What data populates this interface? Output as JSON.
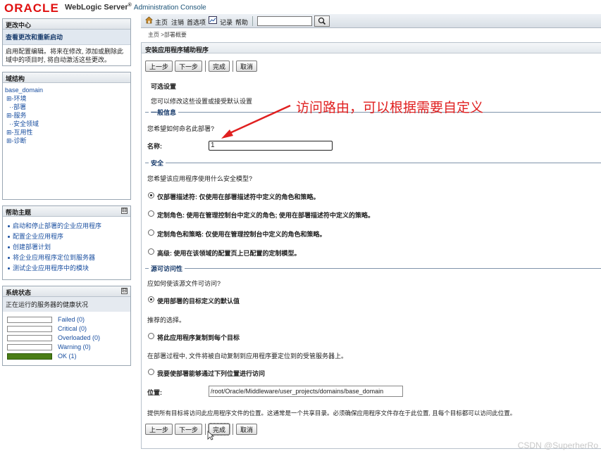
{
  "header": {
    "brand": "ORACLE",
    "product": "WebLogic Server",
    "reg": "®",
    "console": "Administration Console"
  },
  "change_center": {
    "title": "更改中心",
    "link": "查看更改和重新启动",
    "body": "启用配置编辑。将来在修改, 添加或删除此域中的项目时, 将自动激活这些更改。"
  },
  "domain_structure": {
    "title": "域结构",
    "root": "base_domain",
    "items": [
      "⊞-环境",
      "··部署",
      "⊞-服务",
      "··安全领域",
      "⊞-互用性",
      "⊞-诊断"
    ]
  },
  "help_topics": {
    "title": "帮助主题",
    "collapse": "⊟",
    "items": [
      "启动和停止部署的企业应用程序",
      "配置企业应用程序",
      "创建部署计划",
      "将企业应用程序定位到服务器",
      "测试企业应用程序中的模块"
    ]
  },
  "system_status": {
    "title": "系统状态",
    "collapse": "⊟",
    "subtitle": "正在运行的服务器的健康状况",
    "rows": [
      {
        "label": "Failed (0)",
        "fill": 0
      },
      {
        "label": "Critical (0)",
        "fill": 0
      },
      {
        "label": "Overloaded (0)",
        "fill": 0
      },
      {
        "label": "Warning (0)",
        "fill": 0
      },
      {
        "label": "OK (1)",
        "fill": 1
      }
    ]
  },
  "navbar": {
    "home": "主页",
    "logout": "注销",
    "preferences": "首选项",
    "record": "记录",
    "help": "帮助"
  },
  "breadcrumb": "主页 >部署概要",
  "wizard": {
    "title": "安装应用程序辅助程序",
    "buttons": {
      "back": "上一步",
      "next": "下一步",
      "finish": "完成",
      "cancel": "取消"
    },
    "optional_title": "可选设置",
    "optional_desc": "您可以修改这些设置或接受默认设置",
    "general_legend": "一般信息",
    "name_question": "您希望如何命名此部署?",
    "name_label": "名称:",
    "name_value": "1",
    "security_legend": "安全",
    "security_question": "您希望该应用程序使用什么安全模型?",
    "security_options": [
      {
        "label": "仅部署描述符: 仅使用在部署描述符中定义的角色和策略。",
        "checked": true
      },
      {
        "label": "定制角色: 使用在管理控制台中定义的角色; 使用在部署描述符中定义的策略。",
        "checked": false
      },
      {
        "label": "定制角色和策略: 仅使用在管理控制台中定义的角色和策略。",
        "checked": false
      },
      {
        "label": "高级: 使用在该领域的配置页上已配置的定制模型。",
        "checked": false
      }
    ],
    "source_legend": "源可访问性",
    "source_question": "应如何使该源文件可访问?",
    "source_opt1": "使用部署的目标定义的默认值",
    "source_opt1_note": "推荐的选择。",
    "source_opt2": "将此应用程序复制到每个目标",
    "source_opt2_note": "在部署过程中, 文件将被自动复制到应用程序要定位到的受管服务器上。",
    "source_opt3": "我要使部署能够通过下列位置进行访问",
    "location_label": "位置:",
    "location_value": "/root/Oracle/Middleware/user_projects/domains/base_domain",
    "location_note": "提供所有目标将访问此应用程序文件的位置。这通常是一个共享目录。必须确保应用程序文件存在于此位置, 且每个目标都可以访问此位置。"
  },
  "annotation": "访问路由，可以根据需要自定义",
  "watermark": "CSDN @SuperherRo",
  "colors": {
    "annotation": "#e02020",
    "ok_bar": "#4a7d16",
    "brand": "#e01010"
  }
}
